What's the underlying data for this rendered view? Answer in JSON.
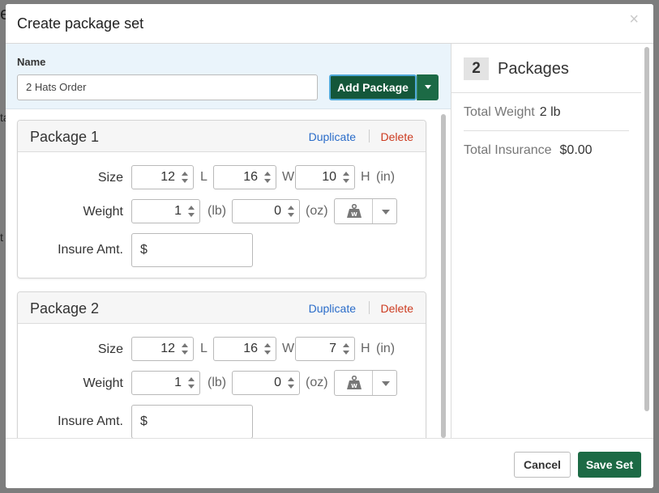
{
  "background": {
    "fragments": [
      "e",
      "ta",
      "t"
    ]
  },
  "modal": {
    "title": "Create package set",
    "close_glyph": "×"
  },
  "name_section": {
    "label": "Name",
    "value": "2 Hats Order",
    "add_button": "Add Package"
  },
  "packages": [
    {
      "title": "Package 1",
      "duplicate": "Duplicate",
      "delete": "Delete",
      "size_label": "Size",
      "length": "12",
      "length_unit": "L",
      "width": "16",
      "width_unit": "W",
      "height": "10",
      "height_unit": "H",
      "dim_unit": "(in)",
      "weight_label": "Weight",
      "lb": "1",
      "lb_unit": "(lb)",
      "oz": "0",
      "oz_unit": "(oz)",
      "insure_label": "Insure Amt.",
      "insure_prefix": "$"
    },
    {
      "title": "Package 2",
      "duplicate": "Duplicate",
      "delete": "Delete",
      "size_label": "Size",
      "length": "12",
      "length_unit": "L",
      "width": "16",
      "width_unit": "W",
      "height": "7",
      "height_unit": "H",
      "dim_unit": "(in)",
      "weight_label": "Weight",
      "lb": "1",
      "lb_unit": "(lb)",
      "oz": "0",
      "oz_unit": "(oz)",
      "insure_label": "Insure Amt.",
      "insure_prefix": "$"
    }
  ],
  "summary": {
    "count": "2",
    "count_label": "Packages",
    "total_weight_label": "Total Weight",
    "total_weight_value": "2 lb",
    "total_insurance_label": "Total Insurance",
    "total_insurance_value": "$0.00"
  },
  "footer": {
    "cancel": "Cancel",
    "save": "Save Set"
  },
  "icons": {
    "close": "close-icon",
    "scale": "scale-icon",
    "dropdown": "chevron-down-icon"
  },
  "colors": {
    "primary_green": "#1c6a45",
    "link_blue": "#2a6cc9",
    "delete_red": "#cc3a1f",
    "name_area_bg": "#eaf4fb"
  }
}
